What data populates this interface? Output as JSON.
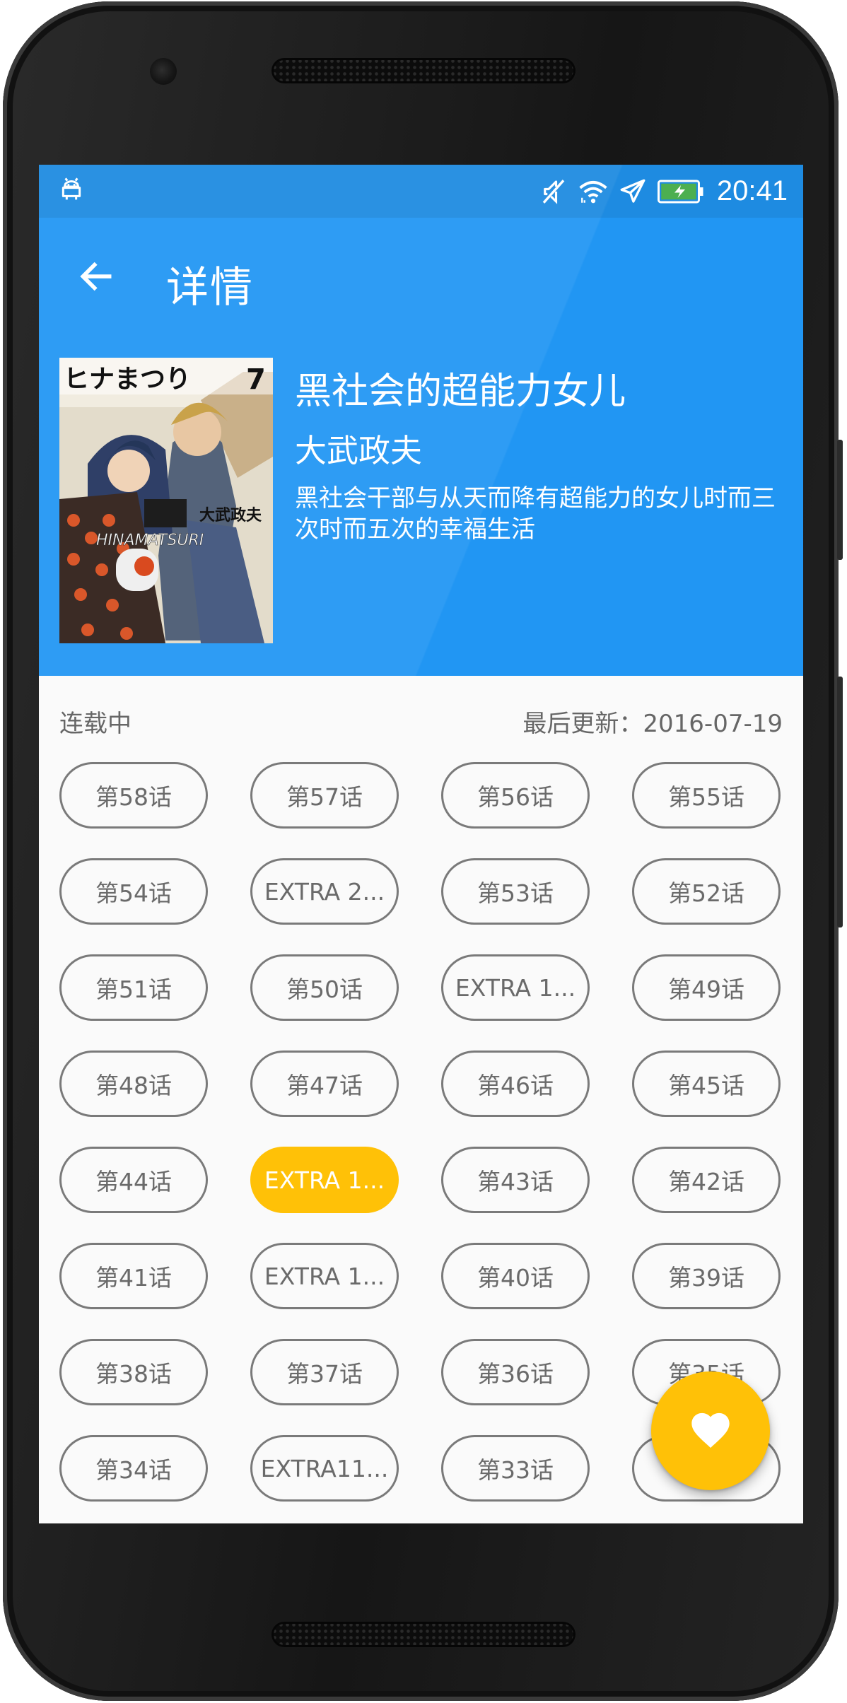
{
  "status_bar": {
    "time": "20:41",
    "icons": [
      "android-notification-icon",
      "mute-icon",
      "wifi-icon",
      "airplane-mode-icon",
      "battery-charging-icon"
    ]
  },
  "toolbar": {
    "title": "详情",
    "back_icon": "arrow-left-icon"
  },
  "comic": {
    "title": "黑社会的超能力女儿",
    "author": "大武政夫",
    "description": "黑社会干部与从天而降有超能力的女儿时而三次时而五次的幸福生活",
    "cover_image": "comic-cover-image",
    "cover_text": {
      "top": "ヒナまつり",
      "volume": "7",
      "author": "大武政夫",
      "logo": "HINAMATSURI"
    }
  },
  "status": {
    "serial": "连载中",
    "last_update": "最后更新：2016-07-19"
  },
  "chapters": [
    {
      "label": "第58话"
    },
    {
      "label": "第57话"
    },
    {
      "label": "第56话"
    },
    {
      "label": "第55话"
    },
    {
      "label": "第54话"
    },
    {
      "label": "EXTRA 2..."
    },
    {
      "label": "第53话"
    },
    {
      "label": "第52话"
    },
    {
      "label": "第51话"
    },
    {
      "label": "第50话"
    },
    {
      "label": "EXTRA 1..."
    },
    {
      "label": "第49话"
    },
    {
      "label": "第48话"
    },
    {
      "label": "第47话"
    },
    {
      "label": "第46话"
    },
    {
      "label": "第45话"
    },
    {
      "label": "第44话"
    },
    {
      "label": "EXTRA 1...",
      "active": true
    },
    {
      "label": "第43话"
    },
    {
      "label": "第42话"
    },
    {
      "label": "第41话"
    },
    {
      "label": "EXTRA 1..."
    },
    {
      "label": "第40话"
    },
    {
      "label": "第39话"
    },
    {
      "label": "第38话"
    },
    {
      "label": "第37话"
    },
    {
      "label": "第36话"
    },
    {
      "label": "第35话"
    },
    {
      "label": "第34话"
    },
    {
      "label": "EXTRA11..."
    },
    {
      "label": "第33话"
    },
    {
      "label": ""
    }
  ],
  "fab": {
    "icon": "heart-icon"
  },
  "colors": {
    "primary": "#2196f3",
    "accent": "#ffc107",
    "background": "#fafafa",
    "chip_border": "#7a7a7a",
    "chip_text": "#6a6a6a"
  }
}
